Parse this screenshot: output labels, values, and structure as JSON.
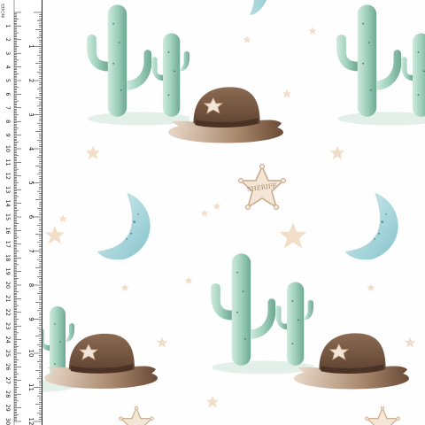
{
  "ruler": {
    "unit_top": "INCHES",
    "unit_bottom": "CENTIMETERS",
    "inch_labels": [
      "1",
      "2",
      "3",
      "4",
      "5",
      "6",
      "7",
      "8",
      "9",
      "10",
      "11",
      "12"
    ],
    "cm_labels": [
      "1",
      "2",
      "3",
      "4",
      "5",
      "6",
      "7",
      "8",
      "9",
      "10",
      "11",
      "12",
      "13",
      "14",
      "15",
      "16",
      "17",
      "18",
      "19",
      "20",
      "21",
      "22",
      "23",
      "24",
      "25",
      "26",
      "27",
      "28",
      "29",
      "30"
    ]
  },
  "pattern": {
    "badge_text": "SHERIFF",
    "background_color": "#fefefe",
    "cactus_color": "#8fc7b1",
    "hat_color": "#7a5a44",
    "moon_color": "#9fd3d8",
    "star_color": "#f1ddc8"
  }
}
